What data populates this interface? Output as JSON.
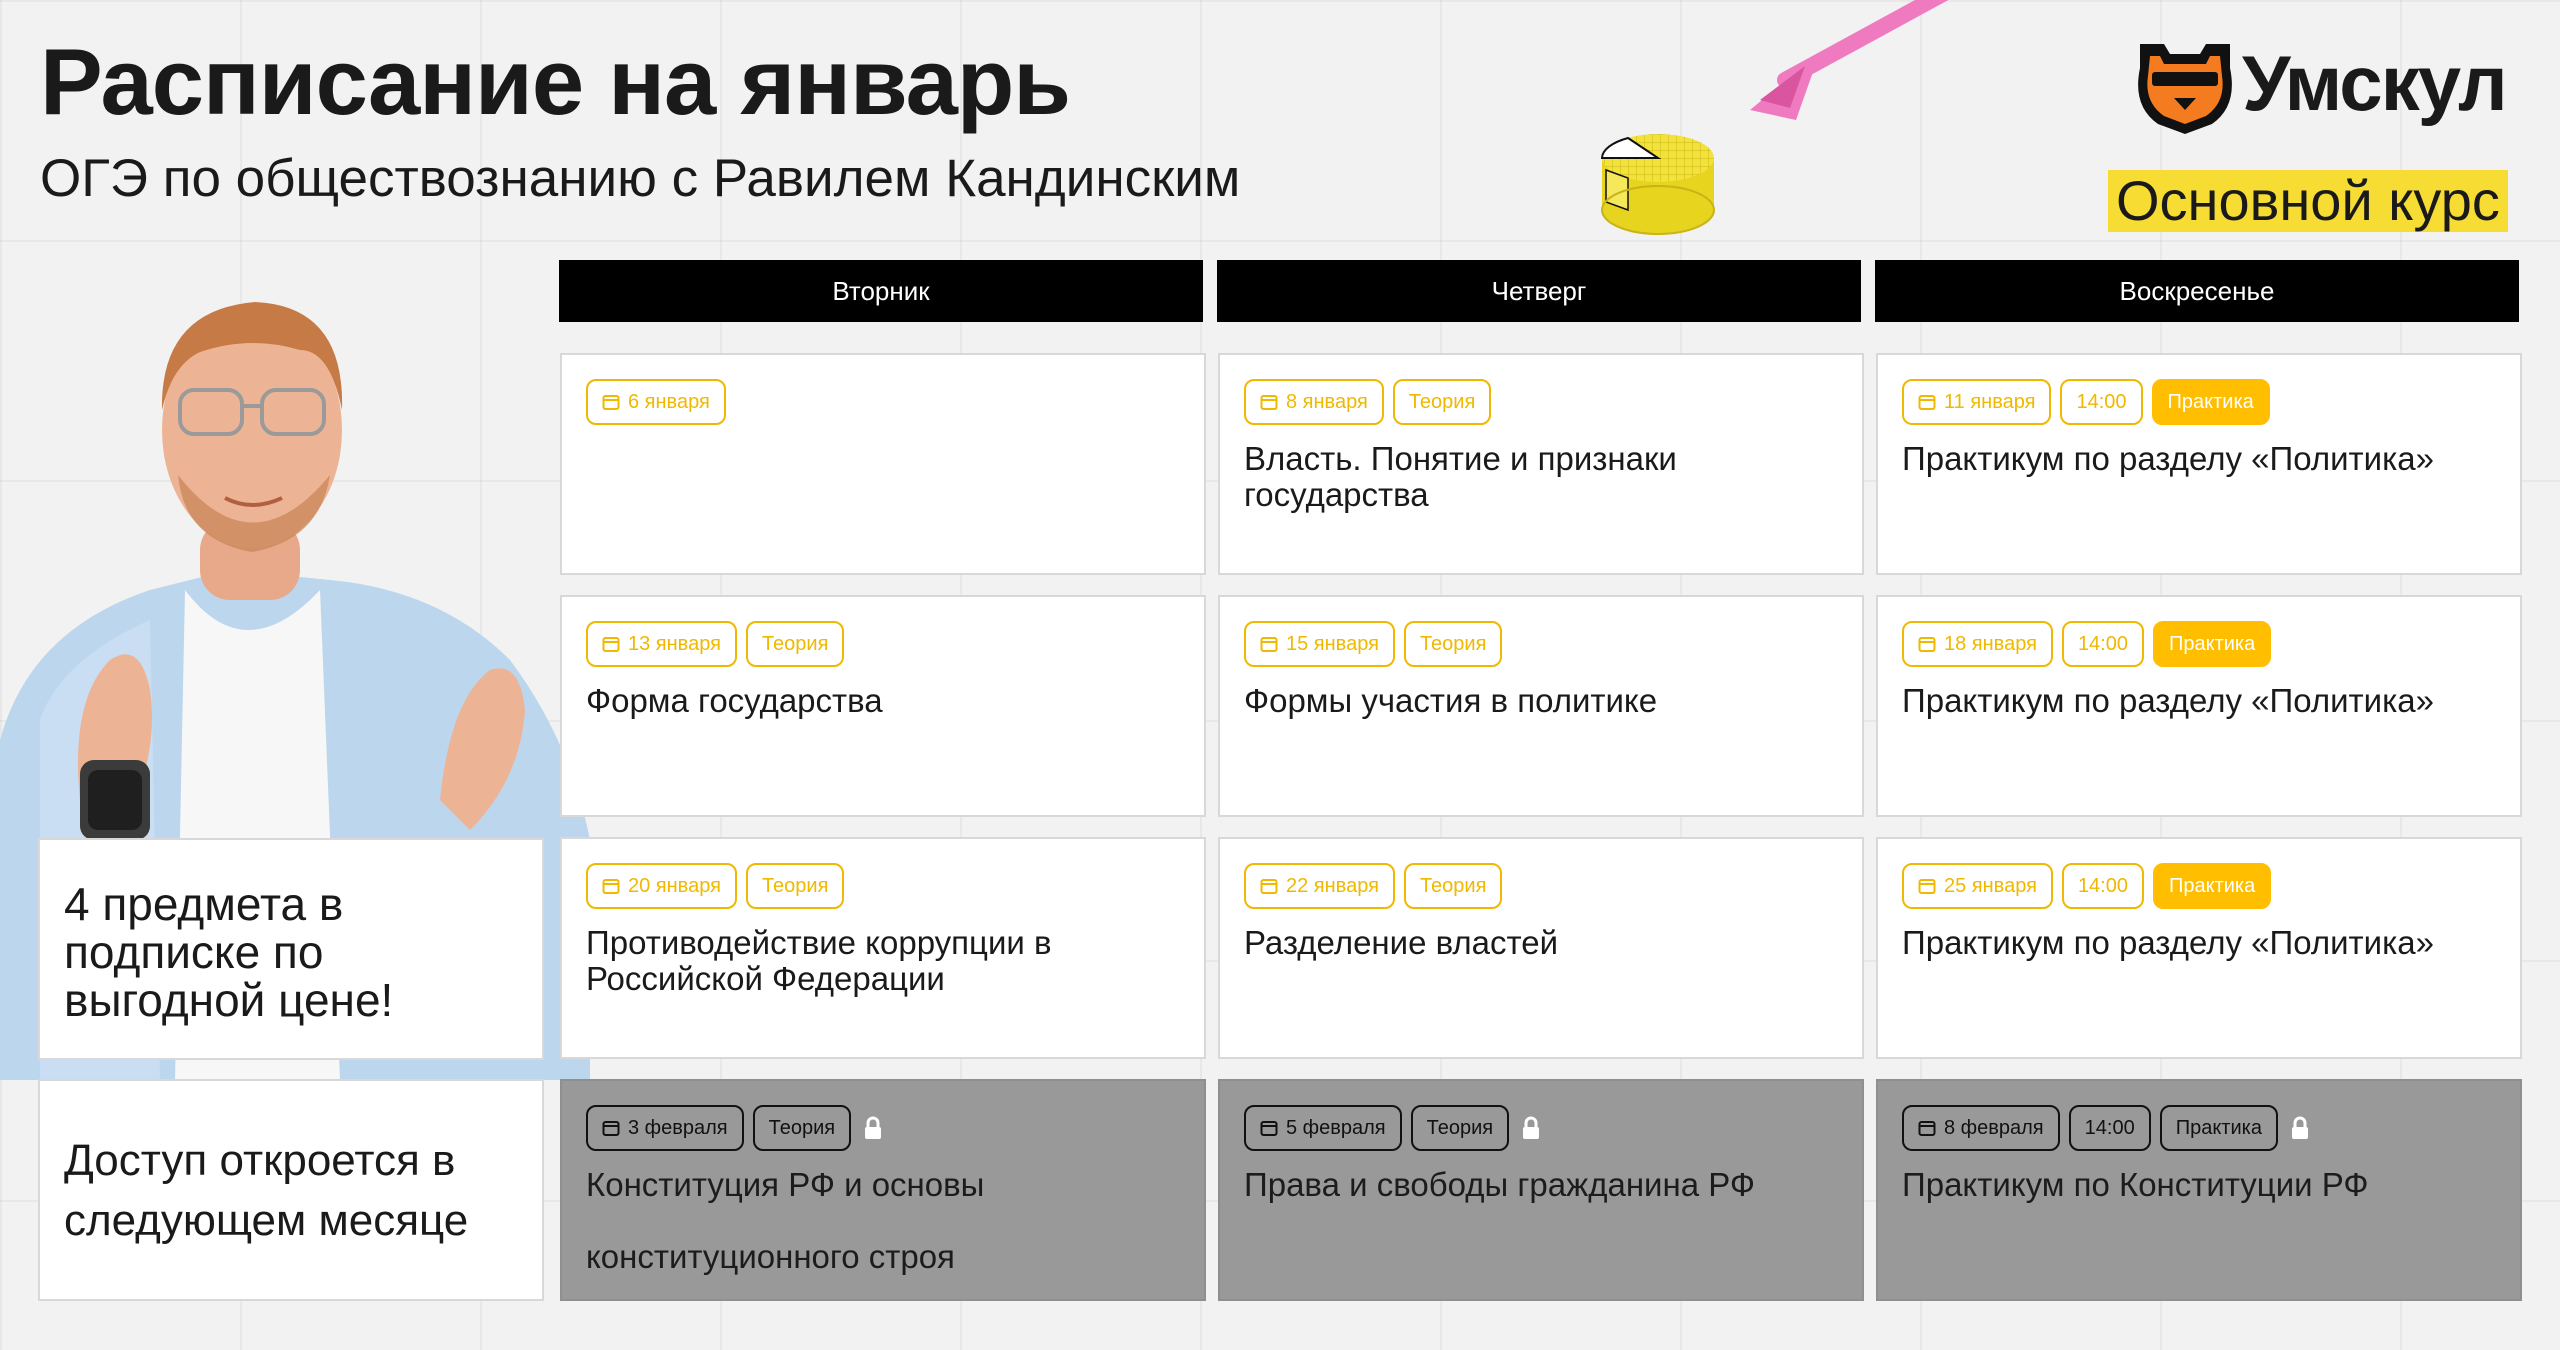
{
  "header": {
    "title": "Расписание на январь",
    "subtitle": "ОГЭ по обществознанию с Равилем Кандинским"
  },
  "brand": {
    "name": "Умскул",
    "course": "Основной курс",
    "accent_color": "#ffbe00",
    "highlight_color": "#f7dc33"
  },
  "days": [
    "Вторник",
    "Четверг",
    "Воскресенье"
  ],
  "weeks": [
    [
      {
        "date": "6 января",
        "time": "",
        "type": "",
        "title": ""
      },
      {
        "date": "8 января",
        "time": "",
        "type": "Теория",
        "title": "Власть. Понятие и признаки государства"
      },
      {
        "date": "11 января",
        "time": "14:00",
        "type": "Практика",
        "title": "Практикум по разделу «Политика»"
      }
    ],
    [
      {
        "date": "13 января",
        "time": "",
        "type": "Теория",
        "title": "Форма государства"
      },
      {
        "date": "15 января",
        "time": "",
        "type": "Теория",
        "title": "Формы участия в политике"
      },
      {
        "date": "18 января",
        "time": "14:00",
        "type": "Практика",
        "title": "Практикум по разделу «Политика»"
      }
    ],
    [
      {
        "date": "20 января",
        "time": "",
        "type": "Теория",
        "title": "Противодействие коррупции в Российской Федерации"
      },
      {
        "date": "22 января",
        "time": "",
        "type": "Теория",
        "title": "Разделение властей"
      },
      {
        "date": "25 января",
        "time": "14:00",
        "type": "Практика",
        "title": "Практикум по разделу «Политика»"
      }
    ]
  ],
  "locked_week": [
    {
      "date": "3 февраля",
      "time": "",
      "type": "Теория",
      "title": "Конституция РФ и основы конституционного строя"
    },
    {
      "date": "5 февраля",
      "time": "",
      "type": "Теория",
      "title": "Права и свободы гражданина РФ"
    },
    {
      "date": "8 февраля",
      "time": "14:00",
      "type": "Практика",
      "title": "Практикум по Конституции РФ"
    }
  ],
  "promo": {
    "text": "4 предмета в подписке по выгодной цене!"
  },
  "access": {
    "text": "Доступ откроется в следующем месяце"
  },
  "icons": {
    "date": "calendar-icon",
    "lock": "lock-icon",
    "logo": "bear-icon"
  }
}
